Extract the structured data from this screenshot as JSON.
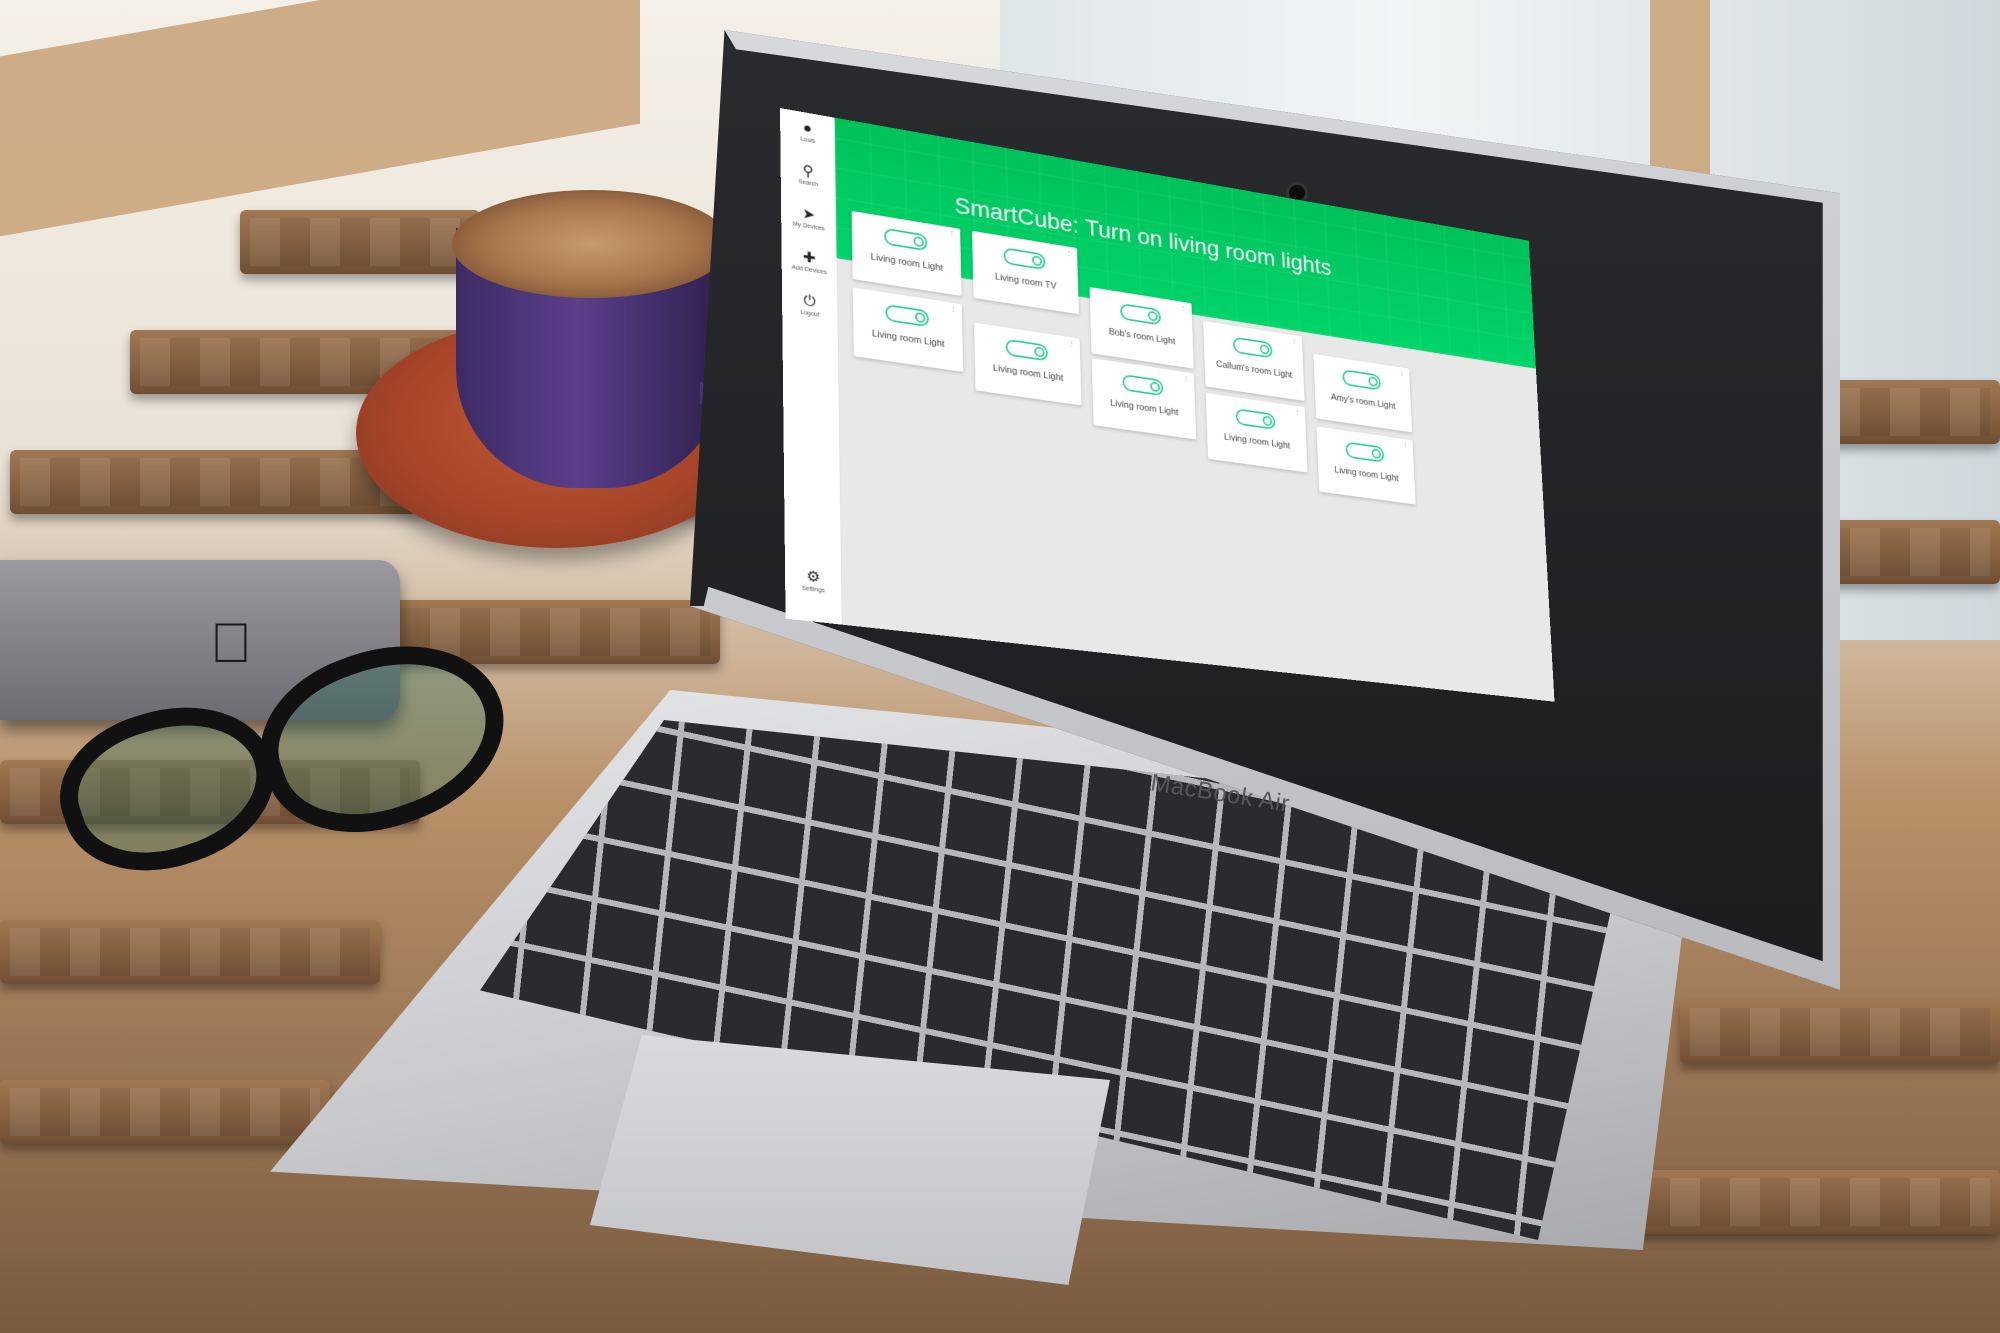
{
  "app": {
    "title": "SmartCube: Turn on living room lights",
    "accent_color": "#00c25a",
    "toggle_color": "#1fd08a"
  },
  "sidebar": {
    "items": [
      {
        "label": "Louis",
        "icon": "user-icon"
      },
      {
        "label": "Search",
        "icon": "search-icon"
      },
      {
        "label": "My Devices",
        "icon": "rocket-icon"
      },
      {
        "label": "Add Devices",
        "icon": "plus-icon"
      },
      {
        "label": "Logout",
        "icon": "power-icon"
      },
      {
        "label": "Settings",
        "icon": "gear-icon"
      }
    ]
  },
  "devices": [
    {
      "name": "Living room Light",
      "state": "off"
    },
    {
      "name": "Living room TV",
      "state": "off"
    },
    {
      "name": "Living room Light",
      "state": "off"
    },
    {
      "name": "Living room Light",
      "state": "off"
    },
    {
      "name": "Bob's room Light",
      "state": "off"
    },
    {
      "name": "Living room Light",
      "state": "off"
    },
    {
      "name": "Callum's room Light",
      "state": "off"
    },
    {
      "name": "Living room Light",
      "state": "off"
    },
    {
      "name": "Amy's room Light",
      "state": "off"
    },
    {
      "name": "Living room Light",
      "state": "off"
    }
  ],
  "laptop": {
    "brand": "MacBook Air"
  }
}
